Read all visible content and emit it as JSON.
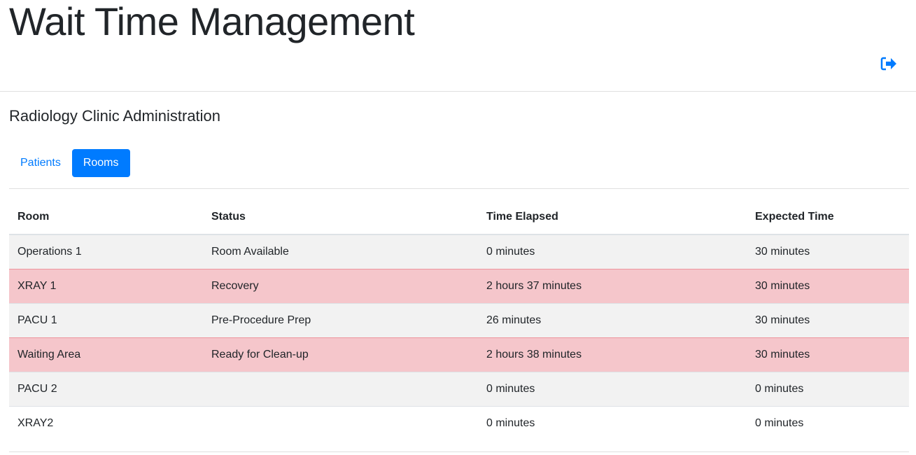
{
  "header": {
    "title": "Wait Time Management"
  },
  "subtitle": "Radiology Clinic Administration",
  "tabs": [
    {
      "label": "Patients"
    },
    {
      "label": "Rooms"
    }
  ],
  "colors": {
    "accent": "#007bff",
    "danger_row": "#f5c6cb",
    "striped_row": "#f2f2f2"
  },
  "table": {
    "columns": [
      "Room",
      "Status",
      "Time Elapsed",
      "Expected Time"
    ],
    "rows": [
      {
        "room": "Operations 1",
        "status": "Room Available",
        "elapsed": "0 minutes",
        "expected": "30 minutes",
        "state": "striped"
      },
      {
        "room": "XRAY 1",
        "status": "Recovery",
        "elapsed": "2 hours 37 minutes",
        "expected": "30 minutes",
        "state": "danger"
      },
      {
        "room": "PACU 1",
        "status": "Pre-Procedure Prep",
        "elapsed": "26 minutes",
        "expected": "30 minutes",
        "state": "striped"
      },
      {
        "room": "Waiting Area",
        "status": "Ready for Clean-up",
        "elapsed": "2 hours 38 minutes",
        "expected": "30 minutes",
        "state": "danger"
      },
      {
        "room": "PACU 2",
        "status": "",
        "elapsed": "0 minutes",
        "expected": "0 minutes",
        "state": "striped"
      },
      {
        "room": "XRAY2",
        "status": "",
        "elapsed": "0 minutes",
        "expected": "0 minutes",
        "state": ""
      }
    ]
  }
}
